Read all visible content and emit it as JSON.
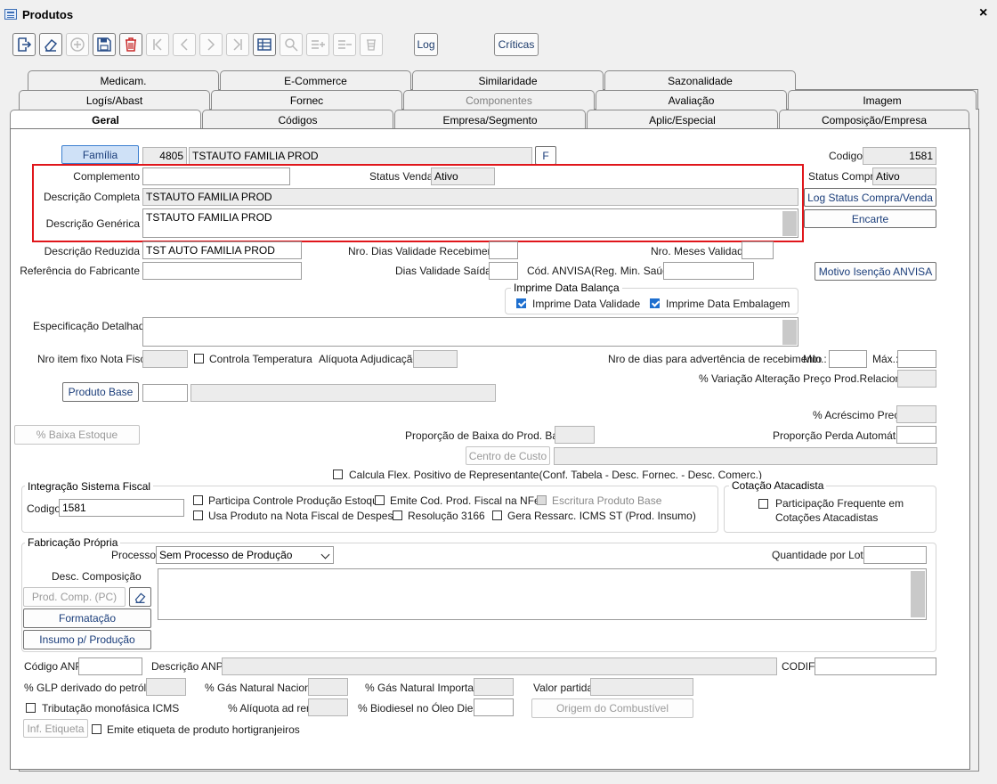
{
  "window": {
    "title": "Produtos",
    "close": "×",
    "minimize": "–"
  },
  "toolbar": {
    "log": "Log",
    "criticas": "Críticas"
  },
  "tabs": {
    "row1": [
      "Medicam.",
      "E-Commerce",
      "Similaridade",
      "Sazonalidade"
    ],
    "row2": [
      "Logís/Abast",
      "Fornec",
      "Componentes",
      "Avaliação",
      "Imagem"
    ],
    "row3": [
      "Geral",
      "Códigos",
      "Empresa/Segmento",
      "Aplic/Especial",
      "Composição/Empresa"
    ]
  },
  "familia": {
    "button": "Família",
    "code": "4805",
    "name": "TSTAUTO FAMILIA PROD",
    "f_button": "F"
  },
  "codigo": {
    "label": "Codigo",
    "value": "1581"
  },
  "complemento": {
    "label": "Complemento",
    "value": ""
  },
  "status_venda": {
    "label": "Status Venda",
    "value": "Ativo"
  },
  "status_compra": {
    "label": "Status Compra",
    "value": "Ativo"
  },
  "log_status": "Log Status Compra/Venda",
  "encarte": "Encarte",
  "descricao_completa": {
    "label": "Descrição Completa",
    "value": "TSTAUTO FAMILIA PROD"
  },
  "descricao_generica": {
    "label": "Descrição Genérica",
    "value": "TSTAUTO FAMILIA PROD"
  },
  "descricao_reduzida": {
    "label": "Descrição Reduzida",
    "value": "TST AUTO FAMILIA PROD"
  },
  "nro_dias_validade": "Nro. Dias Validade Recebimento",
  "nro_meses_validade": "Nro. Meses Validade",
  "referencia_fabricante": "Referência do Fabricante",
  "dias_validade_saidas": "Dias Validade Saídas",
  "cod_anvisa": "Cód. ANVISA(Reg. Min. Saúde)",
  "motivo_anvisa": "Motivo Isenção ANVISA",
  "imprime": {
    "title": "Imprime Data Balança",
    "validade": "Imprime Data Validade",
    "embalagem": "Imprime Data Embalagem"
  },
  "especificacao": "Especificação Detalhada",
  "nro_item_fixo": "Nro item fixo Nota Fiscal",
  "controla_temp": "Controla Temperatura",
  "aliquota_adj": "Alíquota Adjudicação",
  "nro_dias_adv": "Nro de dias para advertência de recebimento",
  "min": "Mín.:",
  "max": "Máx.:",
  "variacao": "% Variação Alteração Preço Prod.Relacionado",
  "produto_base": "Produto Base",
  "acrescimo": "% Acréscimo Preço",
  "baixa_estoque": "% Baixa Estoque",
  "proporcao_baixa": "Proporção de Baixa do Prod. Base",
  "proporcao_perda": "Proporção Perda Automática",
  "centro_custo": "Centro de Custo",
  "calcula_flex": "Calcula Flex. Positivo de Representante(Conf. Tabela - Desc. Fornec. - Desc. Comerc.)",
  "integracao": {
    "title": "Integração Sistema Fiscal",
    "codigo_label": "Codigo",
    "codigo": "1581",
    "participa": "Participa Controle Produção Estoque",
    "emite": "Emite Cod. Prod. Fiscal na NFe",
    "escritura": "Escritura Produto Base",
    "usa": "Usa Produto na Nota Fiscal de Despesa",
    "resolucao": "Resolução 3166",
    "gera": "Gera Ressarc. ICMS ST (Prod. Insumo)"
  },
  "cotacao": {
    "title": "Cotação Atacadista",
    "line1": "Participação Frequente em",
    "line2": "Cotações Atacadistas"
  },
  "fabricacao": {
    "title": "Fabricação Própria",
    "processo_label": "Processo",
    "processo": "Sem Processo de Produção",
    "qtd_lote": "Quantidade por Lote",
    "desc_comp": "Desc. Composição",
    "prod_comp": "Prod. Comp. (PC)",
    "formatacao": "Formatação",
    "insumo": "Insumo p/ Produção"
  },
  "anp": {
    "codigo": "Código ANP",
    "descricao": "Descrição ANP",
    "codif": "CODIF"
  },
  "glp": "% GLP derivado do petróleo",
  "gas_nacional": "% Gás Natural Nacional",
  "gas_importado": "% Gás Natural Importado",
  "valor_partida": "Valor partida",
  "tributacao": "Tributação monofásica ICMS",
  "aliquota_adrem": "% Alíquota ad rem",
  "biodiesel": "% Biodiesel no Óleo Diesel",
  "origem": "Origem do Combustível",
  "inf_etiqueta": "Inf. Etiqueta",
  "emite_etiqueta": "Emite etiqueta de produto hortigranjeiros"
}
